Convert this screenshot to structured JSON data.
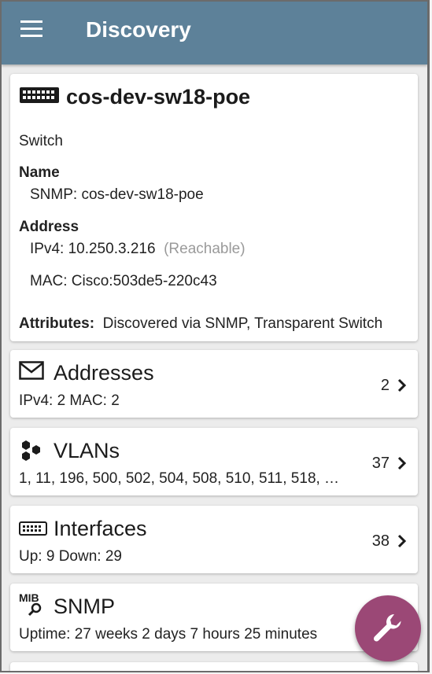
{
  "appbar": {
    "title": "Discovery"
  },
  "device": {
    "name": "cos-dev-sw18-poe",
    "type": "Switch",
    "name_heading": "Name",
    "snmp_line": "SNMP:  cos-dev-sw18-poe",
    "address_heading": "Address",
    "ipv4_line": "IPv4:  10.250.3.216",
    "ipv4_status": "(Reachable)",
    "mac_line": "MAC:  Cisco:503de5-220c43",
    "attributes_label": "Attributes:",
    "attributes_value": "Discovered via SNMP, Transparent Switch"
  },
  "addresses": {
    "title": "Addresses",
    "sub": "IPv4:  2    MAC:  2",
    "count": "2",
    "icon": "envelope-icon"
  },
  "vlans": {
    "title": "VLANs",
    "sub": "1, 11, 196, 500, 502, 504, 508, 510, 511, 518, …",
    "count": "37",
    "icon": "vlan-hexagons-icon"
  },
  "interfaces": {
    "title": "Interfaces",
    "sub": "Up: 9    Down: 29",
    "count": "38",
    "icon": "switch-ports-icon"
  },
  "snmp": {
    "title": "SNMP",
    "sub": "Uptime:  27 weeks 2 days 7 hours 25 minutes",
    "icon": "mib-icon"
  },
  "fab": {
    "icon": "wrench-icon"
  },
  "colors": {
    "appbar": "#5d8199",
    "fab": "#9b4876",
    "muted": "#9a9a9a"
  }
}
